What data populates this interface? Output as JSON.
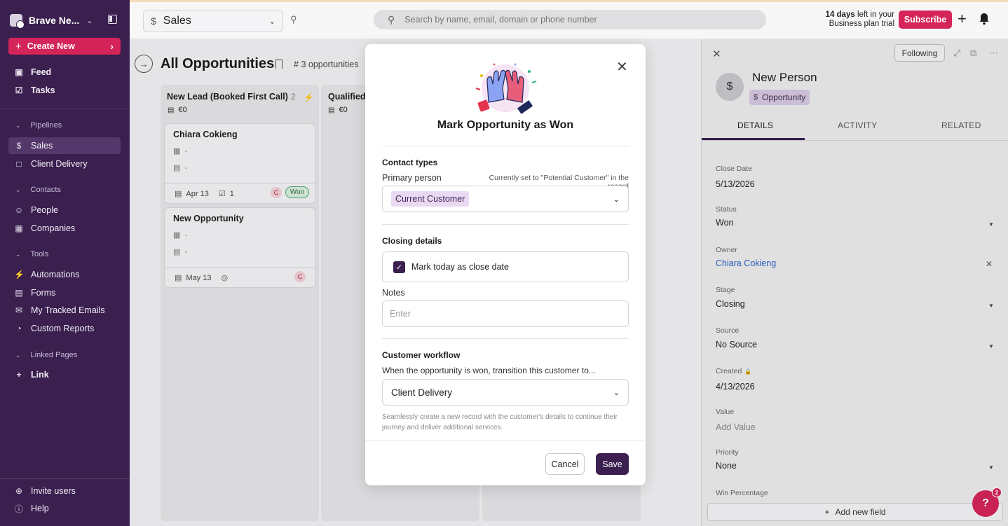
{
  "sidebar": {
    "workspace_name": "Brave Ne...",
    "create_label": "Create New",
    "top_items": [
      {
        "label": "Feed",
        "icon": "inbox-icon"
      },
      {
        "label": "Tasks",
        "icon": "checkbox-icon"
      }
    ],
    "pipelines_label": "Pipelines",
    "pipelines": [
      {
        "label": "Sales",
        "icon": "dollar-icon",
        "active": true
      },
      {
        "label": "Client Delivery",
        "icon": "briefcase-icon",
        "active": false
      }
    ],
    "contacts_label": "Contacts",
    "contacts": [
      {
        "label": "People",
        "icon": "person-icon"
      },
      {
        "label": "Companies",
        "icon": "building-icon"
      }
    ],
    "tools_label": "Tools",
    "tools": [
      {
        "label": "Automations",
        "icon": "bolt-icon"
      },
      {
        "label": "Forms",
        "icon": "clipboard-icon"
      },
      {
        "label": "My Tracked Emails",
        "icon": "mail-icon"
      },
      {
        "label": "Custom Reports",
        "icon": "chart-icon"
      }
    ],
    "linked_label": "Linked Pages",
    "link_label": "Link",
    "invite_label": "Invite users",
    "help_label": "Help"
  },
  "topbar": {
    "pipeline_label": "Sales",
    "search_placeholder": "Search by name, email, domain or phone number",
    "trial_days": "14 days",
    "trial_rest": " left in your",
    "trial_line2": "Business plan trial",
    "subscribe_label": "Subscribe"
  },
  "board": {
    "title": "All Opportunities",
    "count_label": "3 opportunities",
    "columns": [
      {
        "title": "New Lead (Booked First Call)",
        "count": "2",
        "amount": "€0"
      },
      {
        "title": "Qualified (",
        "amount": "€0"
      }
    ],
    "cards": [
      {
        "title": "Chiara Cokieng",
        "line1": "-",
        "line2": "-",
        "date": "Apr 13",
        "tasks": "1",
        "avatar": "C",
        "badge": "Won"
      },
      {
        "title": "New Opportunity",
        "line1": "-",
        "line2": "-",
        "date": "May 13",
        "avatar": "C"
      }
    ]
  },
  "panel": {
    "following_label": "Following",
    "name": "New Person",
    "type_label": "Opportunity",
    "tabs": [
      "DETAILS",
      "ACTIVITY",
      "RELATED"
    ],
    "fields": [
      {
        "label": "Close Date",
        "value": "5/13/2026"
      },
      {
        "label": "Status",
        "value": "Won"
      },
      {
        "label": "Owner",
        "value": "Chiara Cokieng"
      },
      {
        "label": "Stage",
        "value": "Closing"
      },
      {
        "label": "Source",
        "value": "No Source"
      },
      {
        "label": "Created",
        "value": "4/13/2026"
      },
      {
        "label": "Value",
        "value": "Add Value"
      },
      {
        "label": "Priority",
        "value": "None"
      },
      {
        "label": "Win Percentage",
        "value": ""
      }
    ],
    "add_field_label": "Add new field",
    "help_badge": "2"
  },
  "modal": {
    "title": "Mark Opportunity as Won",
    "contact_types_label": "Contact types",
    "primary_person_label": "Primary person",
    "primary_hint": "Currently set to \"Potential Customer\" in the record",
    "primary_value": "Current Customer",
    "closing_label": "Closing details",
    "mark_today_label": "Mark today as close date",
    "mark_today_checked": true,
    "notes_label": "Notes",
    "notes_placeholder": "Enter",
    "workflow_label": "Customer workflow",
    "workflow_question": "When the opportunity is won, transition this customer to...",
    "workflow_value": "Client Delivery",
    "workflow_desc": "Seamlessly create a new record with the customer's details to continue their journey and deliver additional services.",
    "cancel_label": "Cancel",
    "save_label": "Save"
  },
  "colors": {
    "sidebar_bg": "#3a1f4f",
    "accent_pink": "#d4245a",
    "primary_purple": "#3a1f4f",
    "link_blue": "#2b5fc6",
    "won_green": "#d9efdf"
  }
}
